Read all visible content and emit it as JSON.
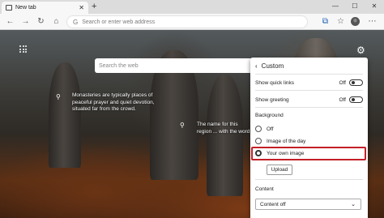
{
  "browser": {
    "tab": {
      "label": "New tab",
      "close_icon": "✕"
    },
    "new_tab_icon": "+",
    "window_controls": [
      "—",
      "☐",
      "✕"
    ],
    "address_placeholder": "Search or enter web address"
  },
  "background": {
    "search_placeholder": "Search the web",
    "caption_left": "Monasteries are typically places of peaceful prayer and quiet devotion, situated far from the crowd.",
    "caption_right": "The name for this region ... with the word meteora, ..."
  },
  "panel": {
    "title": "Custom",
    "show_quick_links": {
      "label": "Show quick links",
      "state": "Off"
    },
    "show_greeting": {
      "label": "Show greeting",
      "state": "Off"
    },
    "background_label": "Background",
    "options": [
      {
        "label": "Off",
        "selected": false
      },
      {
        "label": "Image of the day",
        "selected": false
      },
      {
        "label": "Your own image",
        "selected": true
      }
    ],
    "upload_label": "Upload",
    "content_label": "Content",
    "content_select": "Content off"
  },
  "colors": {
    "highlight": "#c42027",
    "panel_bg": "#ffffff"
  }
}
